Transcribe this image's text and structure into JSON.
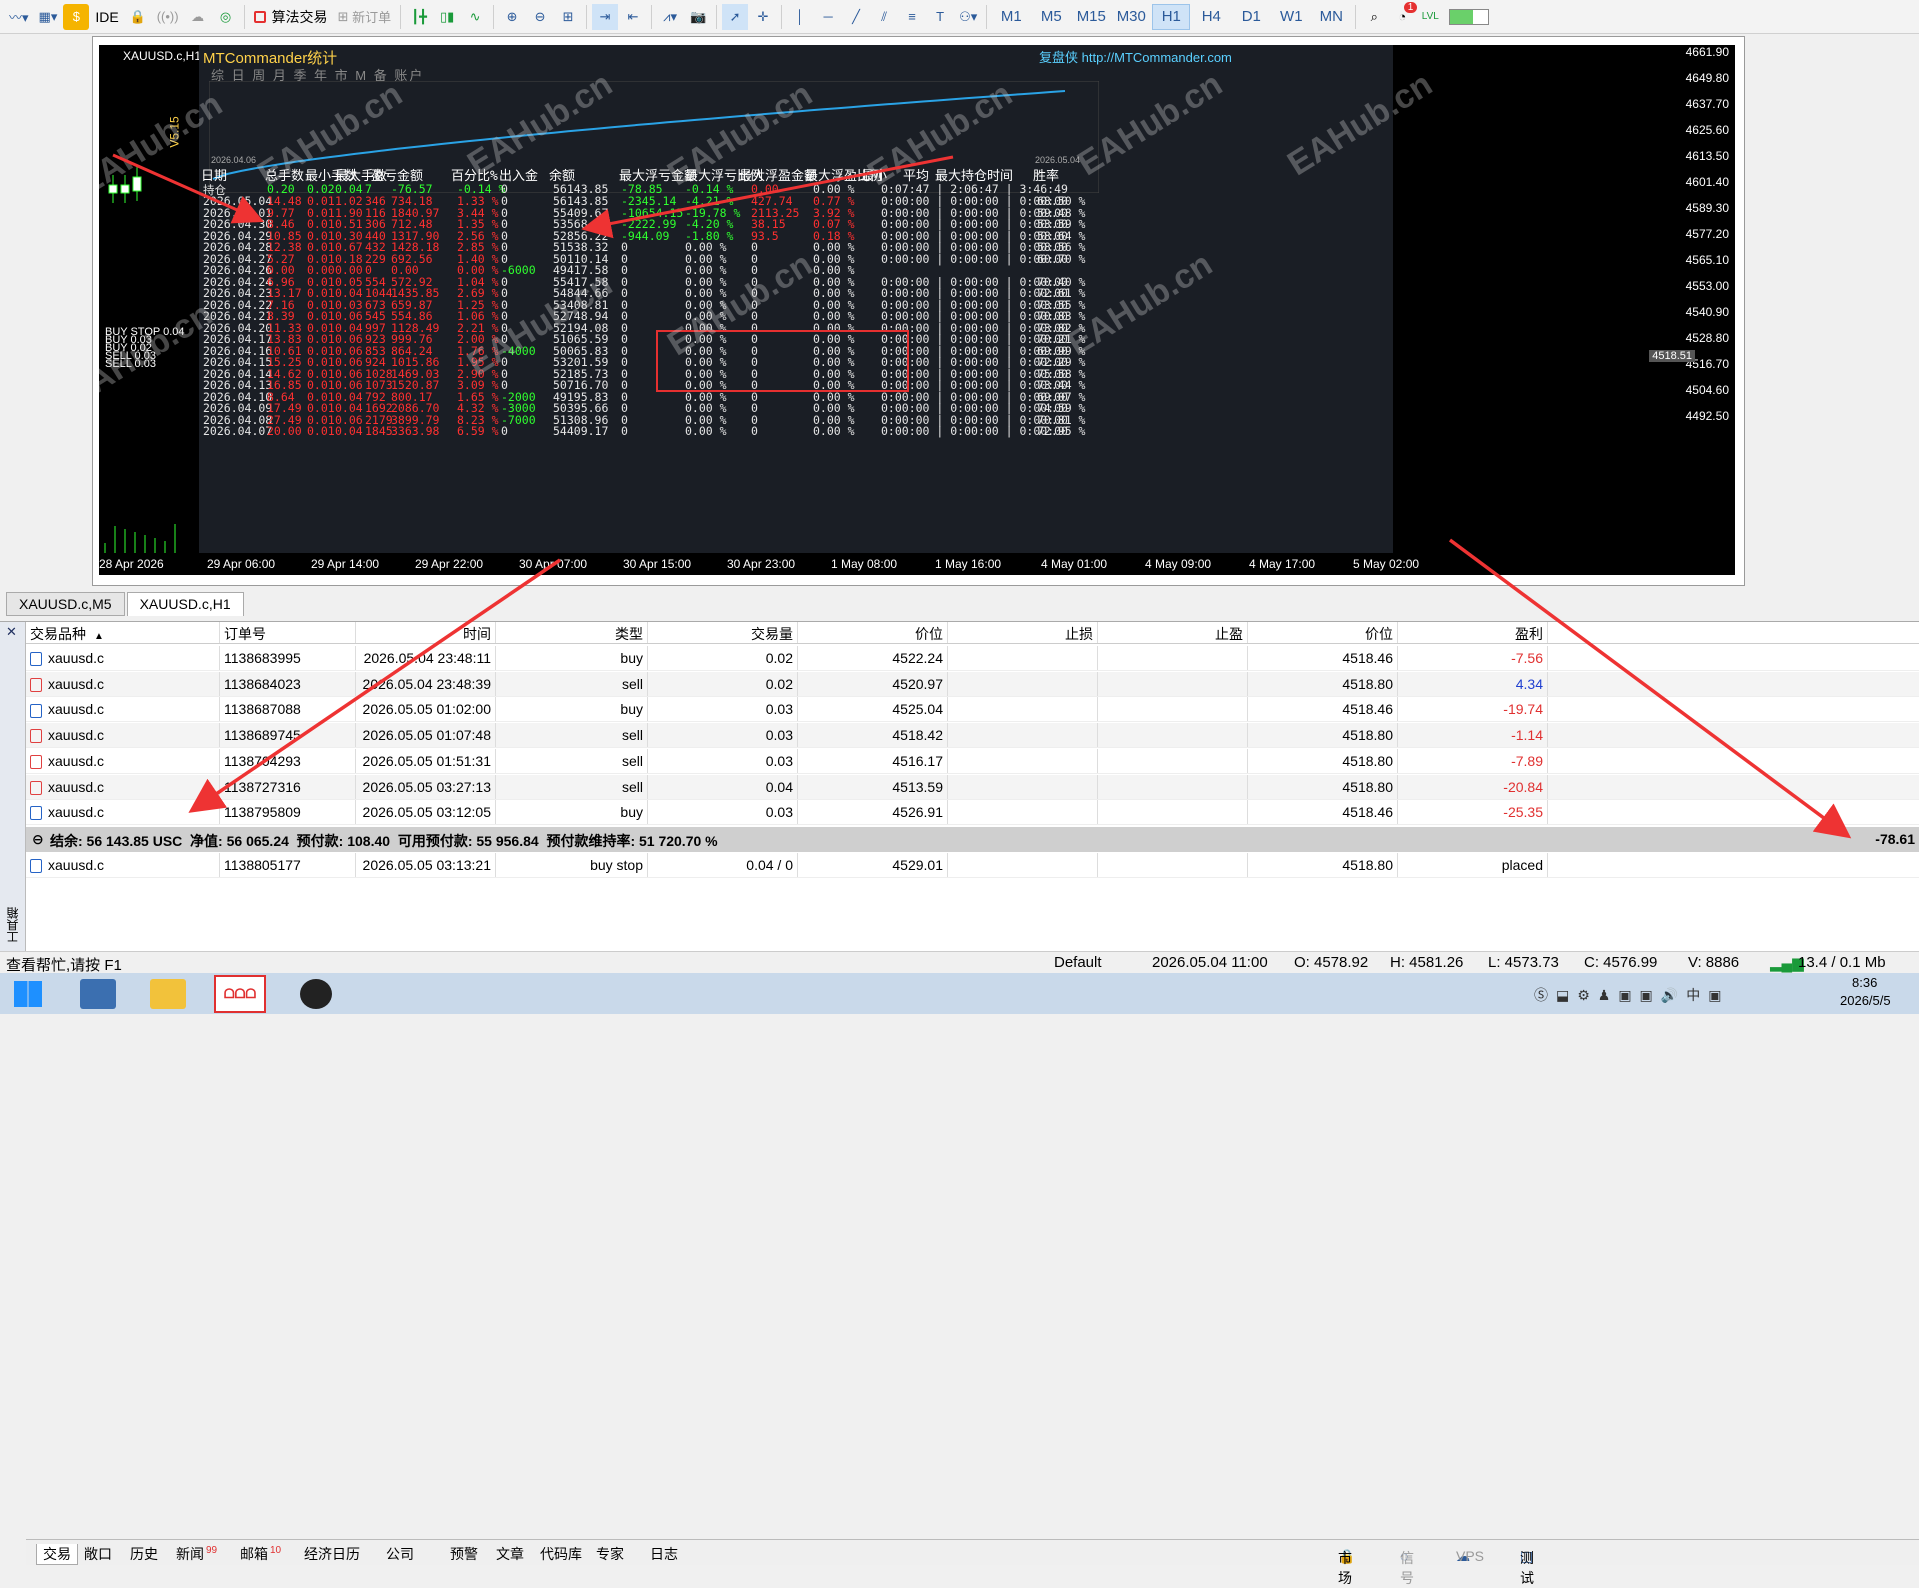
{
  "toolbar": {
    "ide": "IDE",
    "algo_trading": "算法交易",
    "new_order": "新订单",
    "timeframes": [
      "M1",
      "M5",
      "M15",
      "M30",
      "H1",
      "H4",
      "D1",
      "W1",
      "MN"
    ],
    "active_tf": "H1",
    "notification_count": "1"
  },
  "chart": {
    "symbol": "XAUUSD.c,H1",
    "stat_title": "MTCommander统计",
    "stat_link": "复盘侠 http://MTCommander.com",
    "stat_tabs": "综 日 周 月 季 年 市 M 备 账户",
    "date_start": "2026.04.06",
    "date_end": "2026.05.04",
    "version": "V5.15",
    "columns": [
      "日期",
      "总手数",
      "最小手数",
      "最大手数",
      "盈亏金额",
      "百分比%",
      "出入金",
      "余额",
      "最大浮亏金额",
      "最大浮亏比例",
      "最大浮盈金额",
      "最大浮盈比例",
      "最小",
      "平均",
      "最大持仓时间",
      "胜率"
    ],
    "holding": {
      "label": "持仓",
      "lots": "0.20",
      "min": "0.02",
      "max": "0.04",
      "n": "7",
      "pnl": "-76.57",
      "pct": "-0.14 %",
      "inout": "0",
      "bal": "56143.85",
      "mfl": "-78.85",
      "mflp": "-0.14 %",
      "mfp": "0.00",
      "mfpp": "0.00 %",
      "times": "0:07:47 | 2:06:47 | 3:46:49"
    },
    "rows": [
      [
        "2026.05.04",
        "14.48",
        "0.01",
        "1.02",
        "346",
        "734.18",
        "1.33 %",
        "0",
        "56143.85",
        "-2345.14",
        "-4.21 %",
        "427.74",
        "0.77 %",
        "0:00:00 | 0:00:00 | 0:00:00",
        "68.50 %"
      ],
      [
        "2026.05.01",
        "9.77",
        "0.01",
        "1.90",
        "116",
        "1840.97",
        "3.44 %",
        "0",
        "55409.67",
        "-10654.15",
        "-19.78 %",
        "2113.25",
        "3.92 %",
        "0:00:00 | 0:00:00 | 0:00:00",
        "59.48 %"
      ],
      [
        "2026.04.30",
        "8.46",
        "0.01",
        "0.51",
        "306",
        "712.48",
        "1.35 %",
        "0",
        "53568.70",
        "-2222.99",
        "-4.20 %",
        "38.15",
        "0.07 %",
        "0:00:00 | 0:00:00 | 0:00:00",
        "53.59 %"
      ],
      [
        "2026.04.29",
        "10.85",
        "0.01",
        "0.30",
        "440",
        "1317.90",
        "2.56 %",
        "0",
        "52856.22",
        "-944.09",
        "-1.80 %",
        "93.5",
        "0.18 %",
        "0:00:00 | 0:00:00 | 0:00:00",
        "58.64 %"
      ],
      [
        "2026.04.28",
        "12.38",
        "0.01",
        "0.67",
        "432",
        "1428.18",
        "2.85 %",
        "0",
        "51538.32",
        "0",
        "0.00 %",
        "0",
        "0.00 %",
        "0:00:00 | 0:00:00 | 0:00:00",
        "58.56 %"
      ],
      [
        "2026.04.27",
        "5.27",
        "0.01",
        "0.18",
        "229",
        "692.56",
        "1.40 %",
        "0",
        "50110.14",
        "0",
        "0.00 %",
        "0",
        "0.00 %",
        "0:00:00 | 0:00:00 | 0:00:00",
        "60.70 %"
      ],
      [
        "2026.04.26",
        "0.00",
        "0.00",
        "0.00",
        "0",
        "0.00",
        "0.00 %",
        "-6000",
        "49417.58",
        "0",
        "0.00 %",
        "0",
        "0.00 %",
        "",
        ""
      ],
      [
        "2026.04.24",
        "6.96",
        "0.01",
        "0.05",
        "554",
        "572.92",
        "1.04 %",
        "0",
        "55417.58",
        "0",
        "0.00 %",
        "0",
        "0.00 %",
        "0:00:00 | 0:00:00 | 0:00:00",
        "70.40 %"
      ],
      [
        "2026.04.23",
        "13.17",
        "0.01",
        "0.04",
        "1044",
        "1435.85",
        "2.69 %",
        "0",
        "54844.66",
        "0",
        "0.00 %",
        "0",
        "0.00 %",
        "0:00:00 | 0:00:00 | 0:00:00",
        "72.61 %"
      ],
      [
        "2026.04.22",
        "7.16",
        "0.01",
        "0.03",
        "673",
        "659.87",
        "1.25 %",
        "0",
        "53408.81",
        "0",
        "0.00 %",
        "0",
        "0.00 %",
        "0:00:00 | 0:00:00 | 0:00:00",
        "73.55 %"
      ],
      [
        "2026.04.21",
        "8.39",
        "0.01",
        "0.06",
        "545",
        "554.86",
        "1.06 %",
        "0",
        "52748.94",
        "0",
        "0.00 %",
        "0",
        "0.00 %",
        "0:00:00 | 0:00:00 | 0:00:00",
        "70.83 %"
      ],
      [
        "2026.04.20",
        "11.33",
        "0.01",
        "0.04",
        "997",
        "1128.49",
        "2.21 %",
        "0",
        "52194.08",
        "0",
        "0.00 %",
        "0",
        "0.00 %",
        "0:00:00 | 0:00:00 | 0:00:00",
        "73.82 %"
      ],
      [
        "2026.04.17",
        "13.83",
        "0.01",
        "0.06",
        "923",
        "999.76",
        "2.00 %",
        "0",
        "51065.59",
        "0",
        "0.00 %",
        "0",
        "0.00 %",
        "0:00:00 | 0:00:00 | 0:00:00",
        "70.21 %"
      ],
      [
        "2026.04.16",
        "10.61",
        "0.01",
        "0.06",
        "853",
        "864.24",
        "1.76 %",
        "-4000",
        "50065.83",
        "0",
        "0.00 %",
        "0",
        "0.00 %",
        "0:00:00 | 0:00:00 | 0:00:00",
        "69.99 %"
      ],
      [
        "2026.04.15",
        "15.25",
        "0.01",
        "0.06",
        "924",
        "1015.86",
        "1.95 %",
        "0",
        "53201.59",
        "0",
        "0.00 %",
        "0",
        "0.00 %",
        "0:00:00 | 0:00:00 | 0:00:00",
        "72.29 %"
      ],
      [
        "2026.04.14",
        "14.62",
        "0.01",
        "0.06",
        "1028",
        "1469.03",
        "2.90 %",
        "0",
        "52185.73",
        "0",
        "0.00 %",
        "0",
        "0.00 %",
        "0:00:00 | 0:00:00 | 0:00:00",
        "75.58 %"
      ],
      [
        "2026.04.13",
        "16.85",
        "0.01",
        "0.06",
        "1073",
        "1520.87",
        "3.09 %",
        "0",
        "50716.70",
        "0",
        "0.00 %",
        "0",
        "0.00 %",
        "0:00:00 | 0:00:00 | 0:00:00",
        "73.44 %"
      ],
      [
        "2026.04.10",
        "8.64",
        "0.01",
        "0.04",
        "792",
        "800.17",
        "1.65 %",
        "-2000",
        "49195.83",
        "0",
        "0.00 %",
        "0",
        "0.00 %",
        "0:00:00 | 0:00:00 | 0:00:00",
        "69.07 %"
      ],
      [
        "2026.04.09",
        "17.49",
        "0.01",
        "0.04",
        "1692",
        "2086.70",
        "4.32 %",
        "-3000",
        "50395.66",
        "0",
        "0.00 %",
        "0",
        "0.00 %",
        "0:00:00 | 0:00:00 | 0:00:00",
        "74.59 %"
      ],
      [
        "2026.04.08",
        "27.49",
        "0.01",
        "0.06",
        "2179",
        "3899.79",
        "8.23 %",
        "-7000",
        "51308.96",
        "0",
        "0.00 %",
        "0",
        "0.00 %",
        "0:00:00 | 0:00:00 | 0:00:00",
        "70.81 %"
      ],
      [
        "2026.04.07",
        "20.00",
        "0.01",
        "0.04",
        "1845",
        "3363.98",
        "6.59 %",
        "0",
        "54409.17",
        "0",
        "0.00 %",
        "0",
        "0.00 %",
        "0:00:00 | 0:00:00 | 0:00:00",
        "72.95 %"
      ]
    ],
    "pending_labels": [
      "BUY STOP 0.04",
      "BUY 0.03",
      "BUY 0.02",
      "SELL 0.03",
      "SELL 0.03"
    ],
    "yaxis": [
      "4661.90",
      "4649.80",
      "4637.70",
      "4625.60",
      "4613.50",
      "4601.40",
      "4589.30",
      "4577.20",
      "4565.10",
      "4553.00",
      "4540.90",
      "4528.80",
      "4516.70",
      "4504.60",
      "4492.50"
    ],
    "price_tag": "4518.51",
    "xaxis": [
      "28 Apr 2026",
      "29 Apr 06:00",
      "29 Apr 14:00",
      "29 Apr 22:00",
      "30 Apr 07:00",
      "30 Apr 15:00",
      "30 Apr 23:00",
      "1 May 08:00",
      "1 May 16:00",
      "4 May 01:00",
      "4 May 09:00",
      "4 May 17:00",
      "5 May 02:00"
    ],
    "watermark": "EAHub.cn"
  },
  "chart_tabs": [
    "XAUUSD.c,M5",
    "XAUUSD.c,H1"
  ],
  "terminal": {
    "headers": [
      "交易品种",
      "订单号",
      "时间",
      "类型",
      "交易量",
      "价位",
      "止损",
      "止盈",
      "价位",
      "盈利"
    ],
    "orders": [
      {
        "sym": "xauusd.c",
        "id": "1138683995",
        "time": "2026.05.04 23:48:11",
        "type": "buy",
        "vol": "0.02",
        "price": "4522.24",
        "sl": "",
        "tp": "",
        "cur": "4518.46",
        "profit": "-7.56",
        "kind": "buy"
      },
      {
        "sym": "xauusd.c",
        "id": "1138684023",
        "time": "2026.05.04 23:48:39",
        "type": "sell",
        "vol": "0.02",
        "price": "4520.97",
        "sl": "",
        "tp": "",
        "cur": "4518.80",
        "profit": "4.34",
        "kind": "sell"
      },
      {
        "sym": "xauusd.c",
        "id": "1138687088",
        "time": "2026.05.05 01:02:00",
        "type": "buy",
        "vol": "0.03",
        "price": "4525.04",
        "sl": "",
        "tp": "",
        "cur": "4518.46",
        "profit": "-19.74",
        "kind": "buy"
      },
      {
        "sym": "xauusd.c",
        "id": "1138689745",
        "time": "2026.05.05 01:07:48",
        "type": "sell",
        "vol": "0.03",
        "price": "4518.42",
        "sl": "",
        "tp": "",
        "cur": "4518.80",
        "profit": "-1.14",
        "kind": "sell"
      },
      {
        "sym": "xauusd.c",
        "id": "1138704293",
        "time": "2026.05.05 01:51:31",
        "type": "sell",
        "vol": "0.03",
        "price": "4516.17",
        "sl": "",
        "tp": "",
        "cur": "4518.80",
        "profit": "-7.89",
        "kind": "sell"
      },
      {
        "sym": "xauusd.c",
        "id": "1138727316",
        "time": "2026.05.05 03:27:13",
        "type": "sell",
        "vol": "0.04",
        "price": "4513.59",
        "sl": "",
        "tp": "",
        "cur": "4518.80",
        "profit": "-20.84",
        "kind": "sell"
      },
      {
        "sym": "xauusd.c",
        "id": "1138795809",
        "time": "2026.05.05 03:12:05",
        "type": "buy",
        "vol": "0.03",
        "price": "4526.91",
        "sl": "",
        "tp": "",
        "cur": "4518.46",
        "profit": "-25.35",
        "kind": "buy"
      }
    ],
    "summary": "结余: 56 143.85 USC  净值: 56 065.24  预付款: 108.40  可用预付款: 55 956.84  预付款维持率: 51 720.70 %",
    "summary_profit": "-78.61",
    "pending": {
      "sym": "xauusd.c",
      "id": "1138805177",
      "time": "2026.05.05 03:13:21",
      "type": "buy stop",
      "vol": "0.04 / 0",
      "price": "4529.01",
      "cur": "4518.80",
      "profit": "placed"
    },
    "side_label": "工具箱",
    "tabs": [
      "交易",
      "敞口",
      "历史",
      "新闻",
      "邮箱",
      "经济日历",
      "公司",
      "预警",
      "文章",
      "代码库",
      "专家",
      "日志"
    ],
    "news_count": "99",
    "mail_count": "10",
    "right_tabs": [
      "市场",
      "信号",
      "VPS",
      "测试"
    ]
  },
  "status": {
    "help": "查看帮忙,请按 F1",
    "profile": "Default",
    "datetime": "2026.05.04 11:00",
    "open": "O: 4578.92",
    "high": "H: 4581.26",
    "low": "L: 4573.73",
    "close": "C: 4576.99",
    "volume": "V: 8886",
    "traffic": "13.4 / 0.1 Mb"
  },
  "taskbar": {
    "time": "8:36",
    "date": "2026/5/5"
  },
  "colors": {
    "green": "#2fff2f",
    "red": "#ff3030",
    "blue_line": "#2aa3e6",
    "accent": "#2b5a9a",
    "arrow": "#ee3333"
  }
}
